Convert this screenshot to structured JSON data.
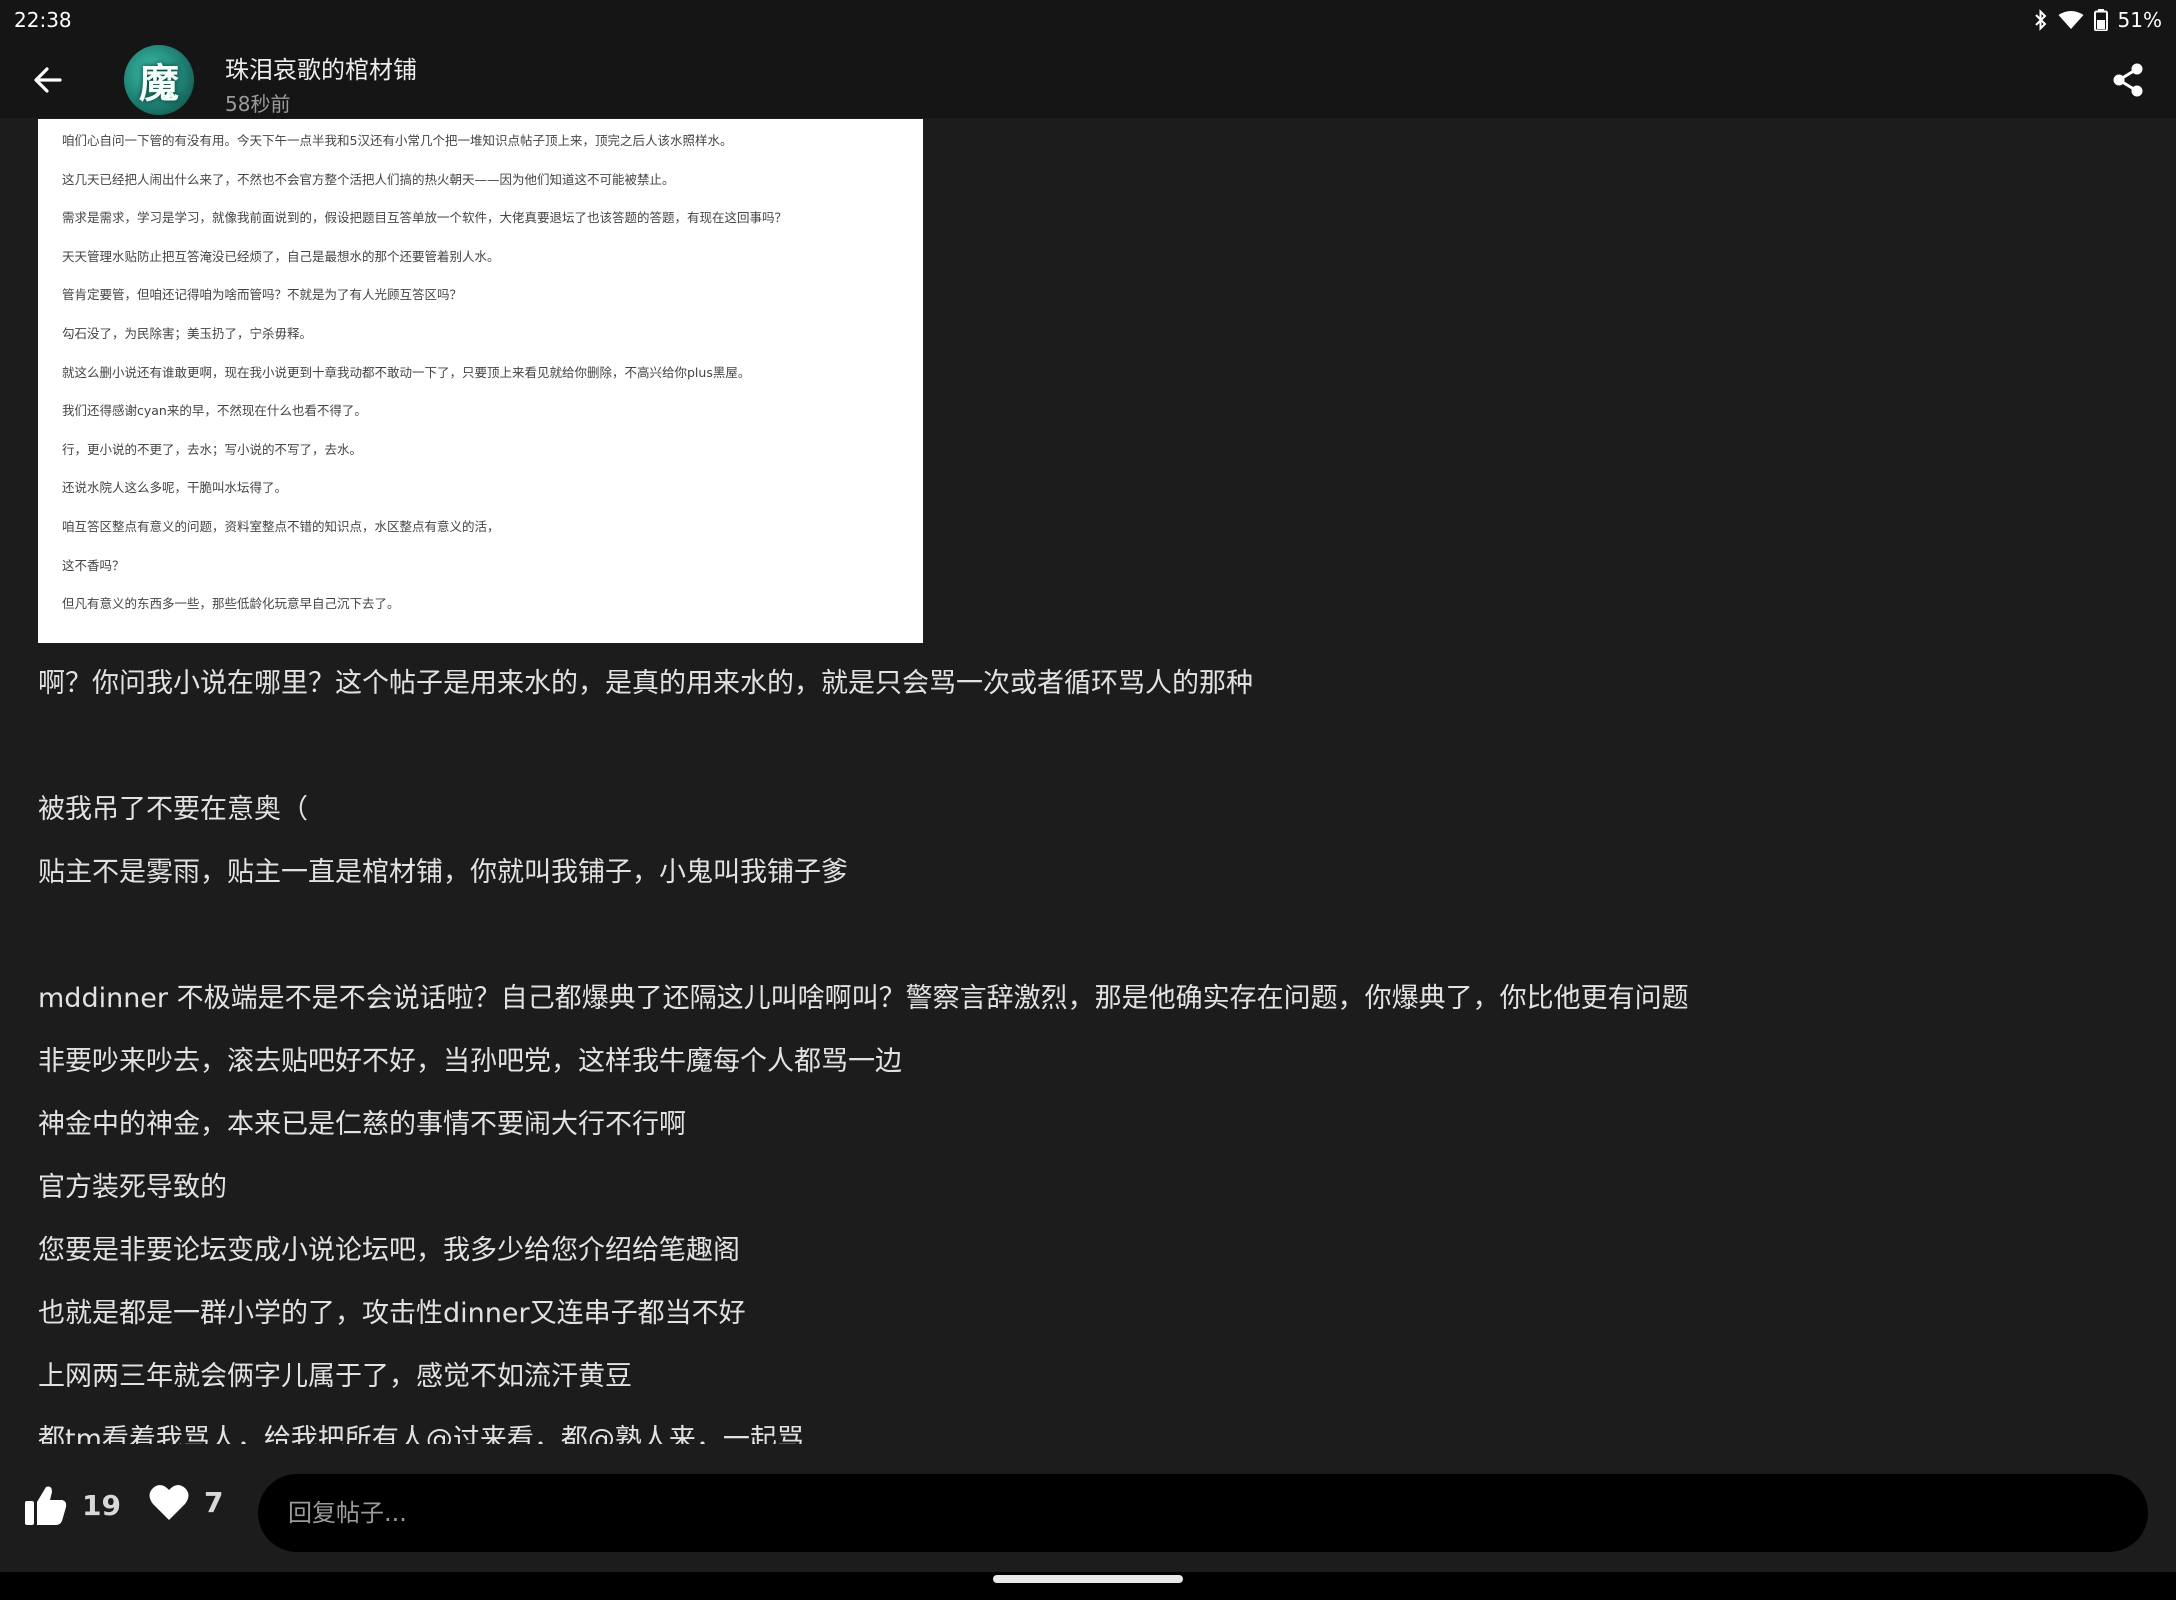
{
  "status_bar": {
    "time": "22:38",
    "battery": "51%",
    "icons": [
      "bluetooth-icon",
      "wifi-icon",
      "battery-icon"
    ]
  },
  "header": {
    "avatar_glyph": "魔",
    "author": "珠泪哀歌的棺材铺",
    "time_ago": "58秒前",
    "back_icon": "arrow-left-icon",
    "share_icon": "share-icon"
  },
  "quote_image": {
    "lines": [
      "咱们心自问一下管的有没有用。今天下午一点半我和5汉还有小常几个把一堆知识点帖子顶上来，顶完之后人该水照样水。",
      "这几天已经把人闹出什么来了，不然也不会官方整个活把人们搞的热火朝天——因为他们知道这不可能被禁止。",
      "需求是需求，学习是学习，就像我前面说到的，假设把题目互答单放一个软件，大佬真要退坛了也该答题的答题，有现在这回事吗？",
      "天天管理水贴防止把互答淹没已经烦了，自己是最想水的那个还要管着别人水。",
      "管肯定要管，但咱还记得咱为啥而管吗？不就是为了有人光顾互答区吗？",
      "勾石没了，为民除害；美玉扔了，宁杀毋释。",
      "就这么删小说还有谁敢更啊，现在我小说更到十章我动都不敢动一下了，只要顶上来看见就给你删除，不高兴给你plus黑屋。",
      "我们还得感谢cyan来的早，不然现在什么也看不得了。",
      "行，更小说的不更了，去水；写小说的不写了，去水。",
      "还说水院人这么多呢，干脆叫水坛得了。",
      "咱互答区整点有意义的问题，资料室整点不错的知识点，水区整点有意义的活，",
      "这不香吗？",
      "但凡有意义的东西多一些，那些低龄化玩意早自己沉下去了。"
    ]
  },
  "post_lines": [
    "啊？你问我小说在哪里？这个帖子是用来水的，是真的用来水的，就是只会骂一次或者循环骂人的那种",
    "",
    "被我吊了不要在意奥（",
    "贴主不是雾雨，贴主一直是棺材铺，你就叫我铺子，小鬼叫我铺子爹",
    "",
    "mddinner 不极端是不是不会说话啦？自己都爆典了还隔这儿叫啥啊叫？警察言辞激烈，那是他确实存在问题，你爆典了，你比他更有问题",
    "非要吵来吵去，滚去贴吧好不好，当孙吧党，这样我牛魔每个人都骂一边",
    "神金中的神金，本来已是仁慈的事情不要闹大行不行啊",
    "官方装死导致的",
    "您要是非要论坛变成小说论坛吧，我多少给您介绍给笔趣阁",
    "也就是都是一群小学的了，攻击性dinner又连串子都当不好",
    "上网两三年就会俩字儿属于了，感觉不如流汗黄豆",
    "都tm看着我骂人，给我把所有人@过来看，都@熟人来，一起骂"
  ],
  "bottom_bar": {
    "like_count": "19",
    "favorite_count": "7",
    "reply_placeholder": "回复帖子..."
  }
}
